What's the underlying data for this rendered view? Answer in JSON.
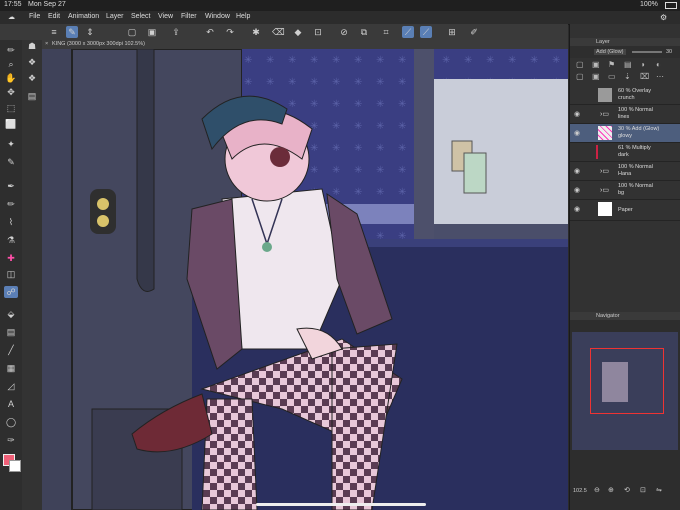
{
  "status": {
    "time": "17:55",
    "date": "Mon Sep 27",
    "battery": "100%"
  },
  "menu": [
    "File",
    "Edit",
    "Animation",
    "Layer",
    "Select",
    "View",
    "Filter",
    "Window",
    "Help"
  ],
  "canvas_tab": "KING (3000 x 3000px 300dpi 102.5%)",
  "layer_panel": {
    "tab": "Layer",
    "blend": "Add (Glow)",
    "opacity": "30",
    "layers": [
      {
        "line1": "60 %  Overlay",
        "line2": "crunch",
        "type": "layer"
      },
      {
        "line1": "100 %  Normal",
        "line2": "lines",
        "type": "folder"
      },
      {
        "line1": "30 %  Add (Glow)",
        "line2": "glowy",
        "type": "layer"
      },
      {
        "line1": "61 %  Multiply",
        "line2": "dark",
        "type": "layer"
      },
      {
        "line1": "100 %  Normal",
        "line2": "Hana",
        "type": "folder"
      },
      {
        "line1": "100 %  Normal",
        "line2": "bg",
        "type": "folder"
      },
      {
        "line1": "",
        "line2": "Paper",
        "type": "paper"
      }
    ]
  },
  "navigator": {
    "title": "Navigator",
    "zoom": "102.5"
  }
}
